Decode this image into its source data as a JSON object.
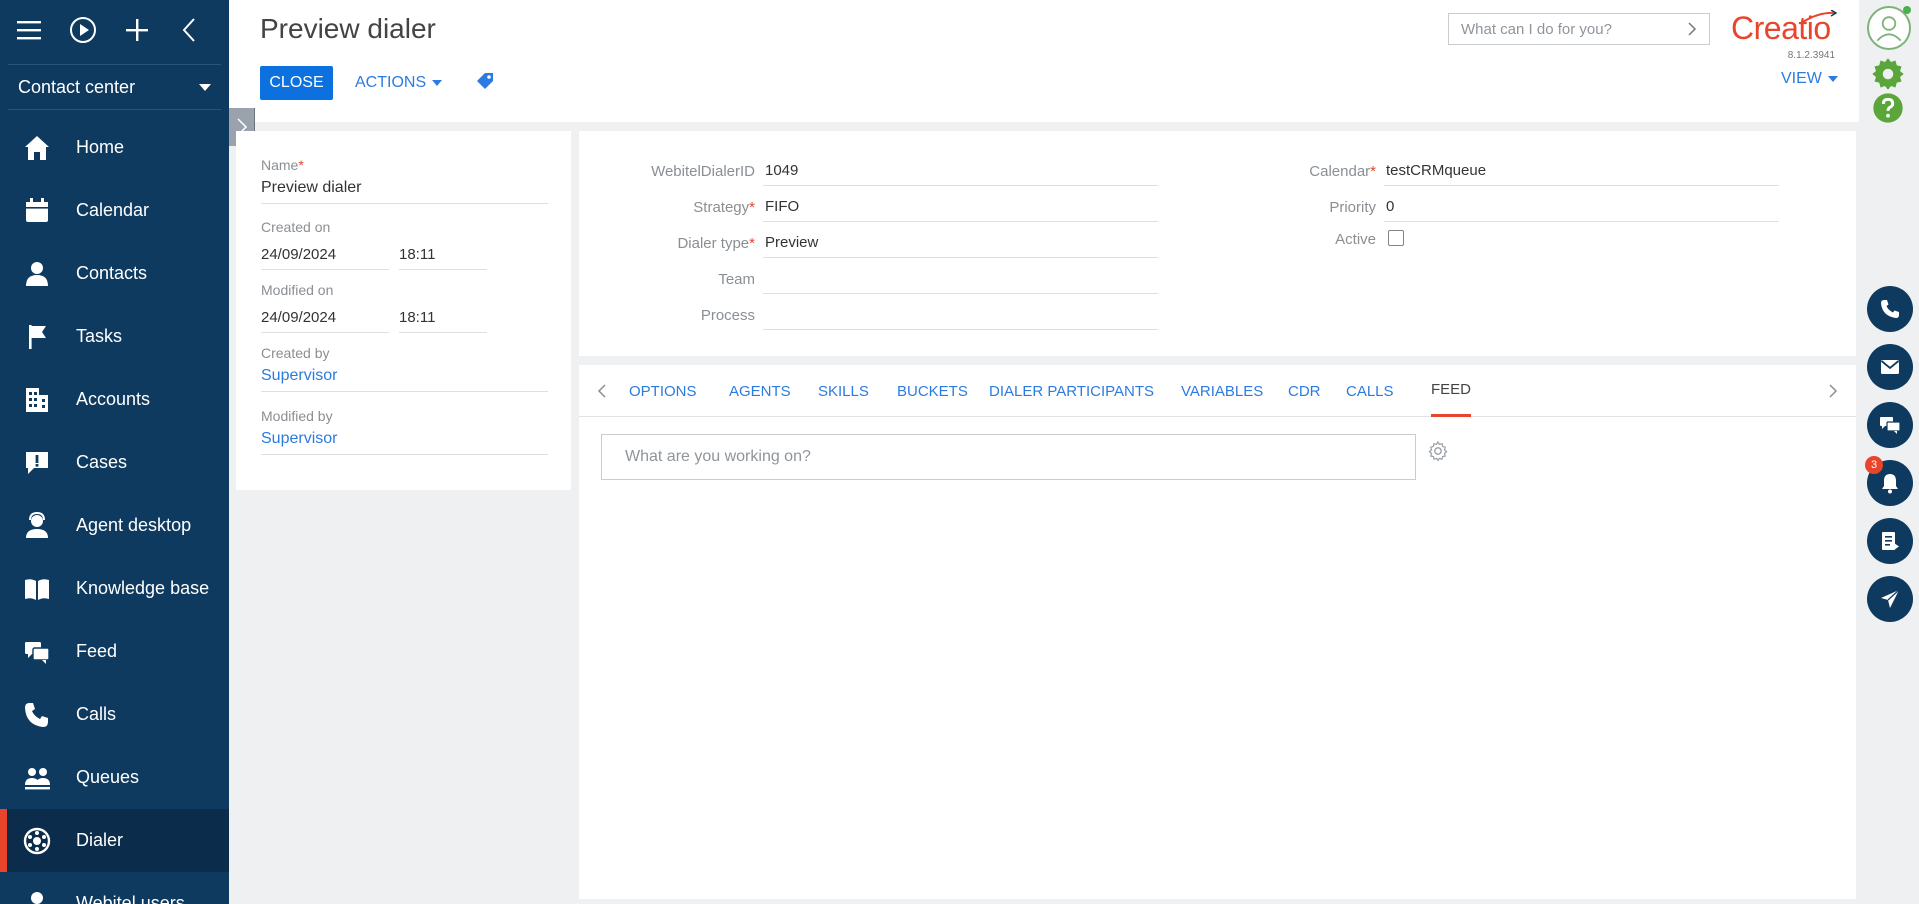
{
  "sidebar": {
    "workspace": "Contact center",
    "items": [
      {
        "label": "Home",
        "icon": "home-icon"
      },
      {
        "label": "Calendar",
        "icon": "calendar-icon"
      },
      {
        "label": "Contacts",
        "icon": "contact-icon"
      },
      {
        "label": "Tasks",
        "icon": "flag-icon"
      },
      {
        "label": "Accounts",
        "icon": "building-icon"
      },
      {
        "label": "Cases",
        "icon": "case-icon"
      },
      {
        "label": "Agent desktop",
        "icon": "agent-icon"
      },
      {
        "label": "Knowledge base",
        "icon": "book-icon"
      },
      {
        "label": "Feed",
        "icon": "feed-icon"
      },
      {
        "label": "Calls",
        "icon": "phone-icon"
      },
      {
        "label": "Queues",
        "icon": "queue-icon"
      },
      {
        "label": "Dialer",
        "icon": "dialer-icon",
        "active": true
      },
      {
        "label": "Webitel users",
        "icon": "user-icon"
      }
    ]
  },
  "header": {
    "title": "Preview dialer",
    "close_label": "CLOSE",
    "actions_label": "ACTIONS",
    "view_label": "VIEW",
    "search_placeholder": "What can I do for you?",
    "logo_text": "Creatio",
    "version": "8.1.2.3941"
  },
  "info": {
    "name_label": "Name",
    "name_value": "Preview dialer",
    "created_on_label": "Created on",
    "created_on_date": "24/09/2024",
    "created_on_time": "18:11",
    "modified_on_label": "Modified on",
    "modified_on_date": "24/09/2024",
    "modified_on_time": "18:11",
    "created_by_label": "Created by",
    "created_by_value": "Supervisor",
    "modified_by_label": "Modified by",
    "modified_by_value": "Supervisor"
  },
  "fields": {
    "dialer_id_label": "WebitelDialerID",
    "dialer_id_value": "1049",
    "strategy_label": "Strategy",
    "strategy_value": "FIFO",
    "dialer_type_label": "Dialer type",
    "dialer_type_value": "Preview",
    "team_label": "Team",
    "team_value": "",
    "process_label": "Process",
    "process_value": "",
    "calendar_label": "Calendar",
    "calendar_value": "testCRMqueue",
    "priority_label": "Priority",
    "priority_value": "0",
    "active_label": "Active",
    "active_checked": false
  },
  "tabs": [
    {
      "label": "OPTIONS"
    },
    {
      "label": "AGENTS"
    },
    {
      "label": "SKILLS"
    },
    {
      "label": "BUCKETS"
    },
    {
      "label": "DIALER PARTICIPANTS"
    },
    {
      "label": "VARIABLES"
    },
    {
      "label": "CDR"
    },
    {
      "label": "CALLS"
    },
    {
      "label": "FEED",
      "active": true
    }
  ],
  "feed": {
    "placeholder": "What are you working on?"
  },
  "rail": {
    "notification_count": "3"
  },
  "colors": {
    "sidebar_bg": "#0f3a5f",
    "accent": "#e8452c",
    "primary_button": "#0c70de",
    "link": "#2c7be0"
  }
}
